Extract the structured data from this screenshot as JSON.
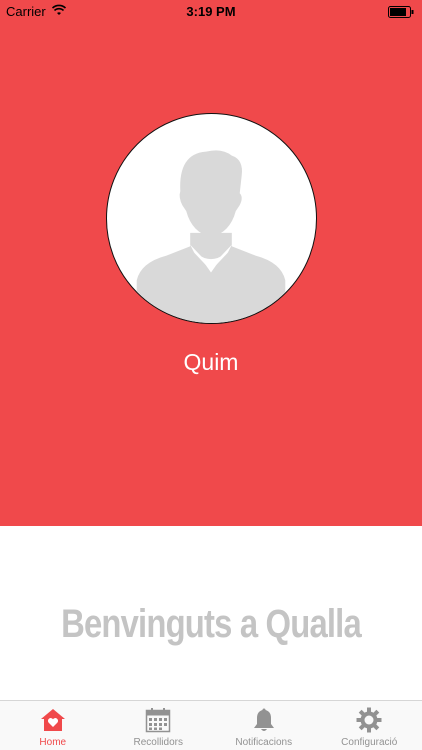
{
  "status_bar": {
    "carrier": "Carrier",
    "time": "3:19 PM"
  },
  "profile": {
    "name": "Quim"
  },
  "welcome": {
    "text": "Benvinguts a Qualla"
  },
  "tab_bar": {
    "active": "Home",
    "tabs": [
      {
        "label": "Home",
        "icon": "home-heart-icon"
      },
      {
        "label": "Recollidors",
        "icon": "calendar-icon"
      },
      {
        "label": "Notificacions",
        "icon": "bell-icon"
      },
      {
        "label": "Configuració",
        "icon": "gear-icon"
      }
    ]
  },
  "colors": {
    "accent": "#f0494b",
    "inactive": "#929292",
    "welcome_text": "#c4c4c4"
  }
}
